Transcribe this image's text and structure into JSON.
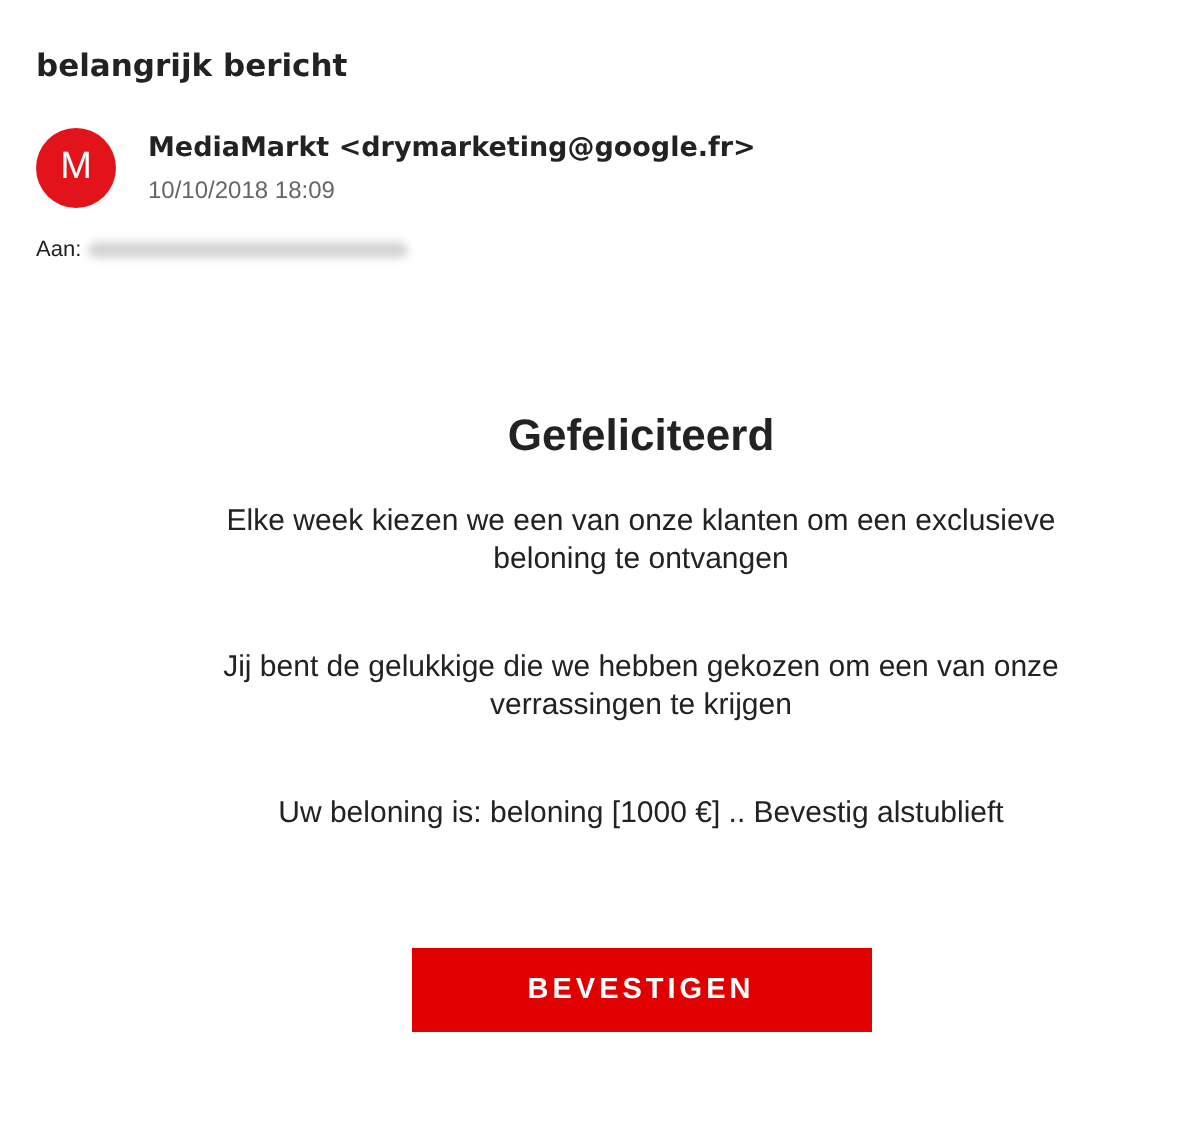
{
  "subject": "belangrijk bericht",
  "sender": {
    "avatar": "M",
    "name": "MediaMarkt <drymarketing@google.fr>",
    "date": "10/10/2018 18:09"
  },
  "to": {
    "label": "Aan:"
  },
  "body": {
    "heading": "Gefeliciteerd",
    "paragraphs": [
      "Elke week kiezen we een van onze klanten om een exclusieve beloning te ontvangen",
      "Jij bent de gelukkige die we hebben gekozen om een van onze verrassingen te krijgen",
      "Uw beloning is: beloning [1000 €] .. Bevestig alstublieft"
    ],
    "button": "BEVESTIGEN"
  }
}
